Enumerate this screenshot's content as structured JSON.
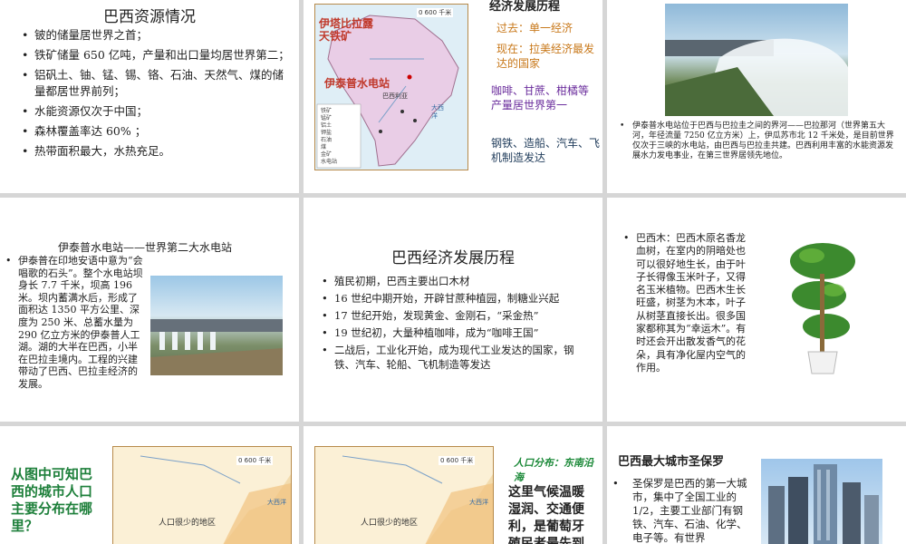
{
  "s1": {
    "title": "巴西资源情况",
    "items": [
      "铍的储量居世界之首；",
      "铁矿储量 650 亿吨，产量和出口量均居世界第二；",
      "铝矾土、铀、锰、锡、铬、石油、天然气、煤的储量都居世界前列；",
      "水能资源仅次于中国；",
      "森林覆盖率达 60% ；",
      "热带面积最大，水热充足。"
    ]
  },
  "s2": {
    "label1": "伊塔比拉露天铁矿",
    "label2": "伊泰普水电站",
    "scale": "0   600 千米",
    "city": "巴西利亚",
    "ocean": "大西洋",
    "legend": [
      "铁矿",
      "锰矿",
      "铝土",
      "钾盐",
      "石油",
      "煤",
      "金矿",
      "水电站"
    ]
  },
  "s3": {
    "title": "经济发展历程",
    "past": "过去：单一经济",
    "now": "现在：拉美经济最发达的国家",
    "crops": "咖啡、甘蔗、柑橘等产量居世界第一",
    "industry": "钢铁、造船、汽车、飞机制造发达"
  },
  "s4": {
    "desc": "伊泰普水电站位于巴西与巴拉圭之间的界河——巴拉那河（世界第五大河，年径流量 7250 亿立方米）上，伊瓜苏市北 12 千米处，是目前世界仅次于三峡的水电站，由巴西与巴拉圭共建。巴西利用丰富的水能资源发展水力发电事业，在第三世界居领先地位。"
  },
  "s5": {
    "title": "伊泰普水电站——世界第二大水电站",
    "desc": "伊泰普在印地安语中意为“会唱歌的石头”。整个水电站坝身长 7.7 千米，坝高 196 米。坝内蓄满水后，形成了面积达 1350 平方公里、深度为 250 米、总蓄水量为 290 亿立方米的伊泰普人工湖。湖的大半在巴西，小半在巴拉圭境内。工程的兴建带动了巴西、巴拉圭经济的发展。"
  },
  "s6": {
    "title": "巴西经济发展历程",
    "items": [
      "殖民初期，巴西主要出口木材",
      "16 世纪中期开始，开辟甘蔗种植园，制糖业兴起",
      "17 世纪开始，发现黄金、金刚石，“采金热”",
      "19 世纪初，大量种植咖啡，成为“咖啡王国”",
      "二战后，工业化开始，成为现代工业发达的国家，钢铁、汽车、轮船、飞机制造等发达"
    ]
  },
  "s7": {
    "desc": "巴西木：巴西木原名香龙血树，在室内的阴暗处也可以很好地生长，由于叶子长得像玉米叶子，又得名玉米植物。巴西木生长旺盛，树茎为木本，叶子从树茎直接长出。很多国家都称其为“幸运木”。有时还会开出散发香气的花朵，具有净化屋内空气的作用。"
  },
  "s8": {
    "question": "从图中可知巴西的城市人口主要分布在哪里？",
    "scale": "0   600 千米",
    "region": "人口很少的地区",
    "ocean": "大西洋"
  },
  "s9": {
    "header": "人口分布：东南沿海",
    "body": "这里气候温暖湿润、交通便利，是葡萄牙殖民者最先到",
    "scale": "0   600 千米",
    "region": "人口很少的地区",
    "ocean": "大西洋"
  },
  "s10": {
    "title": "巴西最大城市圣保罗",
    "desc": "圣保罗是巴西的第一大城市，集中了全国工业的 1/2，主要工业部门有钢铁、汽车、石油、化学、电子等。有世界"
  }
}
